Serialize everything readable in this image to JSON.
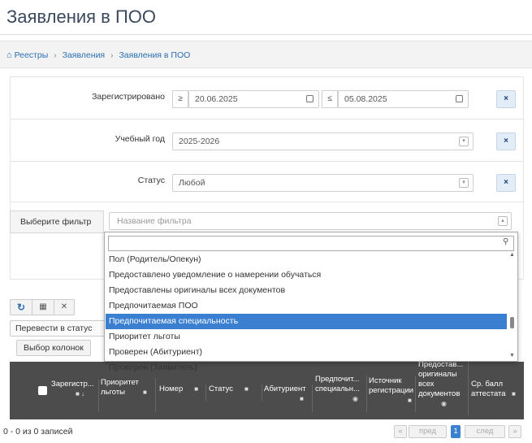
{
  "page_title": "Заявления в ПОО",
  "breadcrumbs": [
    "Реестры",
    "Заявления",
    "Заявления в ПОО"
  ],
  "filters": {
    "registered": {
      "label": "Зарегистрировано",
      "op_from": "≥",
      "from": "20.06.2025",
      "op_to": "≤",
      "to": "05.08.2025"
    },
    "year": {
      "label": "Учебный год",
      "value": "2025-2026"
    },
    "status": {
      "label": "Статус",
      "value": "Любой"
    },
    "clear_icon": "×"
  },
  "filter_select": {
    "label": "Выберите фильтр",
    "placeholder": "Название фильтра",
    "search_value": "",
    "options": [
      "Пол (Родитель/Опекун)",
      "Предоставлено уведомление о намерении обучаться",
      "Предоставлены оригиналы всех документов",
      "Предпочитаемая ПОО",
      "Предпочитаемая специальность",
      "Приоритет льготы",
      "Проверен (Абитуриент)",
      "Проверен (Заявитель)"
    ],
    "selected_index": 4
  },
  "toolbar": {
    "refresh_icon": "refresh-icon",
    "grid_icon": "grid-icon",
    "close_icon": "close-icon",
    "transfer_label": "Перевести в статус",
    "columns_label": "Выбор колонок"
  },
  "table": {
    "columns": [
      "Зарегистр...",
      "Приоритет льготы",
      "Номер",
      "Статус",
      "Абитуриент",
      "Предпочит... специальн...",
      "Источник регистрации",
      "Предостав... оригиналы всех документов",
      "Ср. балл аттестата"
    ]
  },
  "footer": {
    "records": "0 - 0 из 0 записей",
    "prev": "пред",
    "page": "1",
    "next": "след"
  },
  "colors": {
    "accent": "#3a7fd0",
    "header_bg": "#4c4c4c",
    "link": "#2a6fb0"
  }
}
